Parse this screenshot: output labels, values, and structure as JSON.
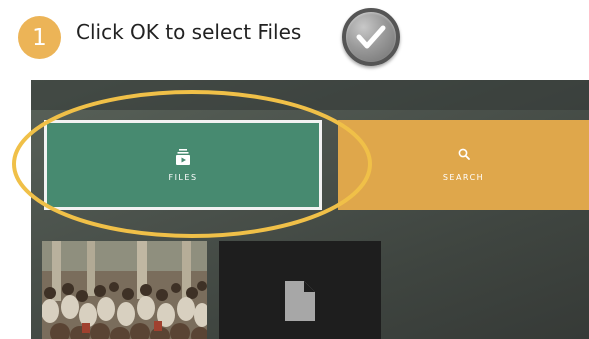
{
  "step": {
    "number": "1",
    "instruction": "Click OK to select Files"
  },
  "ok_button": {
    "icon": "checkmark-icon"
  },
  "menu": {
    "tiles": [
      {
        "label": "FILES",
        "icon": "files-icon",
        "color": "#478a70",
        "selected": true
      },
      {
        "label": "SEARCH",
        "icon": "search-icon",
        "color": "#dfa74b",
        "selected": false
      }
    ]
  },
  "thumbnails": [
    {
      "type": "photo"
    },
    {
      "type": "file",
      "icon": "document-icon"
    }
  ],
  "colors": {
    "accent": "#ecb457",
    "highlight_ring": "#f0c048",
    "files_tile": "#478a70",
    "search_tile": "#dfa74b"
  }
}
